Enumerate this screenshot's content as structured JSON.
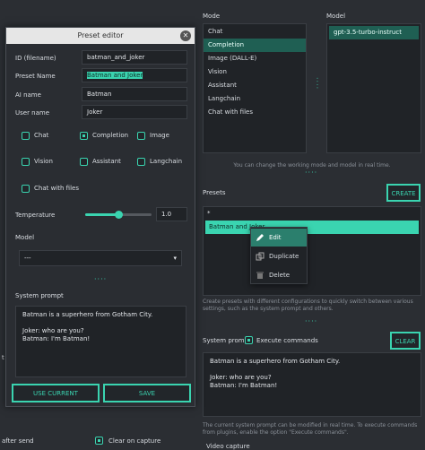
{
  "mode": {
    "label": "Mode",
    "items": [
      "Chat",
      "Completion",
      "Image (DALL-E)",
      "Vision",
      "Assistant",
      "Langchain",
      "Chat with files"
    ],
    "selected_index": 1
  },
  "model": {
    "label": "Model",
    "items": [
      "gpt-3.5-turbo-instruct"
    ]
  },
  "mode_hint": "You can change the working mode and model in real time.",
  "presets": {
    "label": "Presets",
    "create_label": "CREATE",
    "items": [
      "*",
      "Batman and Joker"
    ],
    "selected_index": 1,
    "hint": "Create presets with different configurations to quickly switch between various settings, such as the system prompt and others."
  },
  "context_menu": {
    "edit_label": "Edit",
    "duplicate_label": "Duplicate",
    "delete_label": "Delete"
  },
  "system_prompt_panel": {
    "label": "System prompt",
    "execute_label": "Execute commands",
    "clear_label": "CLEAR",
    "lines": [
      "Batman is a superhero from Gotham City.",
      "",
      "Joker: who are you?",
      "Batman: I'm Batman!"
    ],
    "hint": "The current system prompt can be modified in real time. To execute commands from plugins, enable the option \"Execute commands\".",
    "video_capture": "Video capture"
  },
  "bottom": {
    "after_send_label": "after send",
    "clear_on_capture_label": "Clear on capture",
    "left_fragment": "t"
  },
  "dialog": {
    "title": "Preset editor",
    "fields": {
      "id_label": "ID (filename)",
      "id_value": "batman_and_joker",
      "preset_name_label": "Preset Name",
      "preset_name_value": "Batman and Joker",
      "ai_name_label": "AI name",
      "ai_name_value": "Batman",
      "user_name_label": "User name",
      "user_name_value": "Joker"
    },
    "modes": [
      {
        "label": "Chat",
        "checked": false
      },
      {
        "label": "Completion",
        "checked": true
      },
      {
        "label": "Image",
        "checked": false
      },
      {
        "label": "Vision",
        "checked": false
      },
      {
        "label": "Assistant",
        "checked": false
      },
      {
        "label": "Langchain",
        "checked": false
      },
      {
        "label": "Chat with files",
        "checked": false
      }
    ],
    "temperature_label": "Temperature",
    "temperature_value": "1.0",
    "temperature_fraction": 0.5,
    "model_label": "Model",
    "model_value": "---",
    "system_prompt_label": "System prompt",
    "system_prompt_lines": [
      "Batman is a superhero from Gotham City.",
      "",
      "Joker: who are you?",
      "Batman: I'm Batman!"
    ],
    "use_current_label": "USE CURRENT",
    "save_label": "SAVE"
  },
  "colors": {
    "accent": "#3ad4b0",
    "background": "#2b2e33",
    "list_bg": "#202327",
    "selection": "#1f5f53",
    "preset_selection": "#3ad4b0"
  }
}
